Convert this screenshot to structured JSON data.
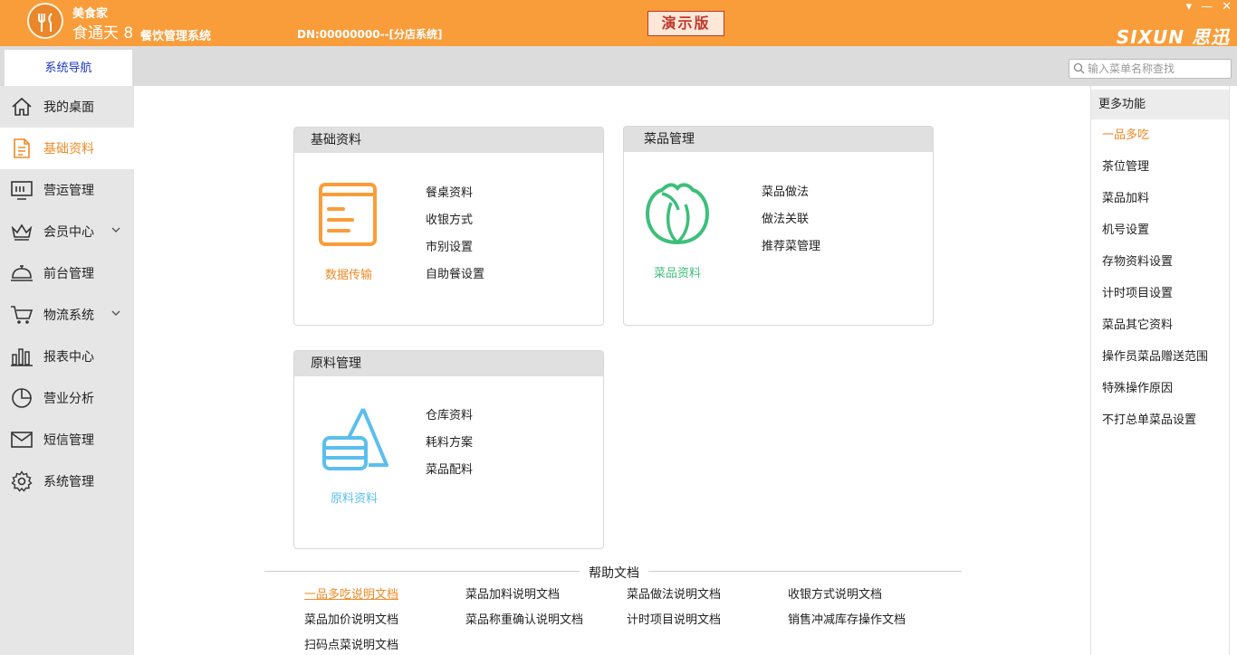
{
  "header": {
    "brand_top": "美食家",
    "brand_main": "食通天 8",
    "brand_sub": "餐饮管理系统",
    "dn": "DN:00000000--[分店系统]",
    "demo_badge": "演示版",
    "company": "SIXUN 思迅",
    "window_controls": [
      "▾",
      "—",
      "✕"
    ]
  },
  "toolbar": {
    "nav_tab": "系统导航",
    "search_placeholder": "输入菜单名称查找"
  },
  "sidebar": {
    "items": [
      {
        "label": "我的桌面",
        "icon": "home-icon"
      },
      {
        "label": "基础资料",
        "icon": "document-icon",
        "active": true
      },
      {
        "label": "营运管理",
        "icon": "monitor-icon"
      },
      {
        "label": "会员中心",
        "icon": "crown-icon",
        "expandable": true
      },
      {
        "label": "前台管理",
        "icon": "cloche-icon"
      },
      {
        "label": "物流系统",
        "icon": "cart-icon",
        "expandable": true
      },
      {
        "label": "报表中心",
        "icon": "bar-chart-icon"
      },
      {
        "label": "营业分析",
        "icon": "pie-chart-icon"
      },
      {
        "label": "短信管理",
        "icon": "envelope-icon"
      },
      {
        "label": "系统管理",
        "icon": "gear-icon"
      }
    ]
  },
  "cards": {
    "basic": {
      "title": "基础资料",
      "caption": "数据传输",
      "links": [
        "餐桌资料",
        "收银方式",
        "市别设置",
        "自助餐设置"
      ]
    },
    "dish": {
      "title": "菜品管理",
      "caption": "菜品资料",
      "links": [
        "菜品做法",
        "做法关联",
        "推荐菜管理"
      ]
    },
    "material": {
      "title": "原料管理",
      "caption": "原料资料",
      "links": [
        "仓库资料",
        "耗料方案",
        "菜品配料"
      ]
    }
  },
  "help": {
    "title": "帮助文档",
    "links": [
      "一品多吃说明文档",
      "菜品加料说明文档",
      "菜品做法说明文档",
      "收银方式说明文档",
      "菜品加价说明文档",
      "菜品称重确认说明文档",
      "计时项目说明文档",
      "销售冲减库存操作文档",
      "扫码点菜说明文档"
    ]
  },
  "right_panel": {
    "title": "更多功能",
    "items": [
      "一品多吃",
      "茶位管理",
      "菜品加料",
      "机号设置",
      "存物资料设置",
      "计时项目设置",
      "菜品其它资料",
      "操作员菜品赠送范围",
      "特殊操作原因",
      "不打总单菜品设置"
    ]
  },
  "colors": {
    "header_orange": "#f99d3a",
    "accent_orange": "#f08a24",
    "dish_green": "#3dbf7b",
    "material_blue": "#5bbfee",
    "nav_blue": "#1a37c9",
    "demo_red": "#c0392b"
  }
}
